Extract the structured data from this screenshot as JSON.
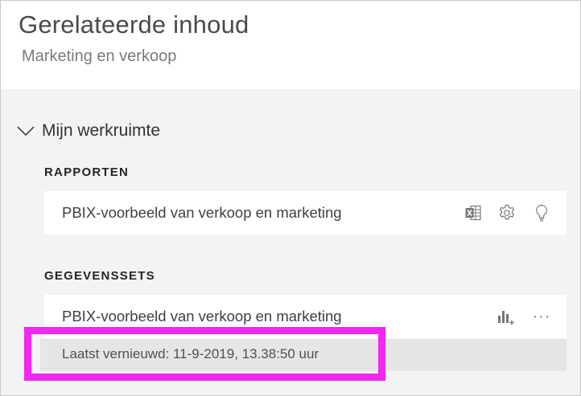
{
  "header": {
    "title": "Gerelateerde inhoud",
    "subtitle": "Marketing en verkoop"
  },
  "workspace": {
    "label": "Mijn werkruimte",
    "expanded": true
  },
  "reports": {
    "heading": "RAPPORTEN",
    "items": [
      {
        "label": "PBIX-voorbeeld van verkoop en marketing",
        "icons": [
          "excel-icon",
          "gear-icon",
          "lightbulb-icon"
        ]
      }
    ]
  },
  "datasets": {
    "heading": "GEGEVENSSETS",
    "items": [
      {
        "label": "PBIX-voorbeeld van verkoop en marketing",
        "icons": [
          "create-report-icon",
          "more-options-icon"
        ],
        "more_glyph": "···",
        "refresh_text": "Laatst vernieuwd: 11-9-2019, 13.38:50 uur"
      }
    ]
  },
  "colors": {
    "highlight": "#f227f0",
    "panel_bg": "#f3f3f3",
    "card_bg": "#ffffff"
  }
}
